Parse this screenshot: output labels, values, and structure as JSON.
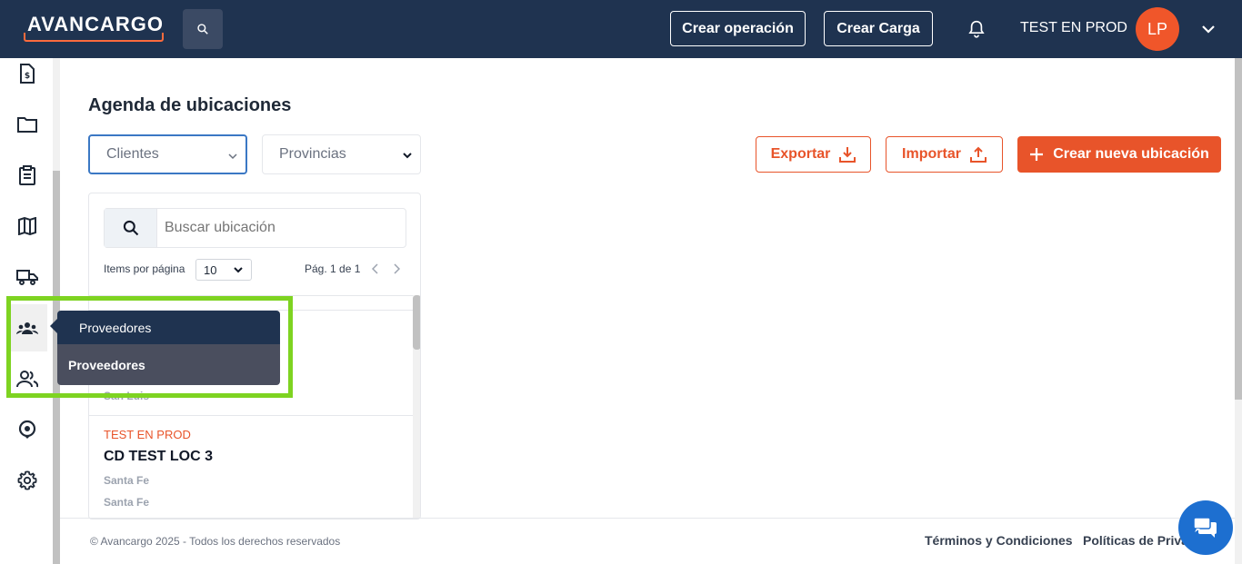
{
  "header": {
    "logo": "AVANCARGO",
    "create_operation": "Crear operación",
    "create_load": "Crear Carga",
    "user_name": "TEST EN PROD",
    "avatar_initials": "LP"
  },
  "sidebar": {
    "items": [
      {
        "icon": "invoice-icon"
      },
      {
        "icon": "folder-icon"
      },
      {
        "icon": "clipboard-icon"
      },
      {
        "icon": "map-icon"
      },
      {
        "icon": "truck-icon"
      },
      {
        "icon": "suppliers-group-icon"
      },
      {
        "icon": "users-icon"
      },
      {
        "icon": "location-pin-icon"
      },
      {
        "icon": "gear-icon"
      }
    ],
    "tooltip": {
      "title": "Proveedores",
      "item": "Proveedores"
    }
  },
  "main": {
    "title": "Agenda de ubicaciones",
    "filters": {
      "clients": "Clientes",
      "provinces": "Provincias"
    },
    "actions": {
      "export": "Exportar",
      "import": "Importar",
      "create": "Crear nueva ubicación"
    },
    "search": {
      "placeholder": "Buscar ubicación"
    },
    "pagination": {
      "items_per_page_label": "Items por página",
      "items_per_page_value": "10",
      "page_text": "Pág. 1 de 1"
    },
    "rows": [
      {
        "sub": "San Luis"
      },
      {
        "client": "TEST EN PROD",
        "name": "CD TEST LOC 3",
        "city": "Santa Fe",
        "province": "Santa Fe"
      }
    ]
  },
  "footer": {
    "copyright": "© Avancargo 2025 - Todos los derechos reservados",
    "terms": "Términos y Condiciones",
    "privacy": "Políticas de Priva"
  },
  "colors": {
    "navy": "#1f3350",
    "accent": "#e8542a",
    "highlight": "#7ed321",
    "chat": "#1d6fd0"
  }
}
